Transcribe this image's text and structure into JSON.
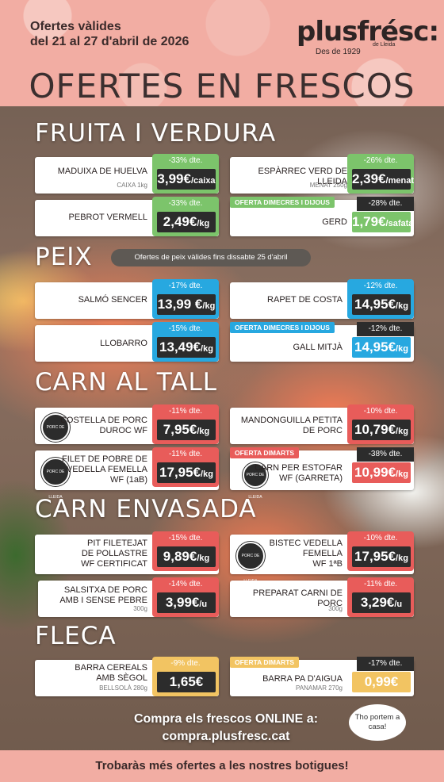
{
  "header": {
    "validity_line1": "Ofertes vàlides",
    "validity_line2": "del 21 al 27 d'abril de 2026",
    "logo": "plusfrésc:",
    "logo_sub": "Des de 1929",
    "logo_sub2": "de Lleida",
    "headline": "OFERTES EN FRESCOS"
  },
  "sections": {
    "fruita": "FRUITA I VERDURA",
    "peix": "PEIX",
    "peix_note": "Ofertes de peix vàlides fins dissabte 25 d'abril",
    "carn_tall": "CARN AL TALL",
    "carn_envasada": "CARN ENVASADA",
    "fleca": "FLECA"
  },
  "products": [
    {
      "name": "MADUIXA DE HUELVA",
      "unit": "CAIXA 1kg",
      "discount": "-33% dte.",
      "price": "3,99€",
      "price_unit": "/caixa",
      "color": "#7cc46b"
    },
    {
      "name": "ESPÀRREC VERD DE LLEIDA",
      "unit": "MENAT 250g",
      "discount": "-26% dte.",
      "price": "2,39€",
      "price_unit": "/menat",
      "color": "#7cc46b"
    },
    {
      "name": "PEBROT VERMELL",
      "unit": "",
      "discount": "-33% dte.",
      "price": "2,49€",
      "price_unit": "/kg",
      "color": "#7cc46b"
    },
    {
      "name": "GERD",
      "unit": "",
      "offer": "OFERTA DIMECRES I DIJOUS",
      "discount": "-28% dte.",
      "price": "1,79€",
      "price_unit": "/safata",
      "color": "#7cc46b"
    },
    {
      "name": "SALMÓ SENCER",
      "unit": "",
      "discount": "-17% dte.",
      "price": "13,99 €",
      "price_unit": "/kg",
      "color": "#27a8e0"
    },
    {
      "name": "RAPET DE COSTA",
      "unit": "",
      "discount": "-12% dte.",
      "price": "14,95€",
      "price_unit": "/kg",
      "color": "#27a8e0"
    },
    {
      "name": "LLOBARRO",
      "unit": "",
      "discount": "-15% dte.",
      "price": "13,49€",
      "price_unit": "/kg",
      "color": "#27a8e0"
    },
    {
      "name": "GALL MITJÀ",
      "unit": "",
      "offer": "OFERTA DIMECRES I DIJOUS",
      "discount": "-12% dte.",
      "price": "14,95€",
      "price_unit": "/kg",
      "color": "#27a8e0"
    },
    {
      "name_l1": "COSTELLA DE PORC",
      "name_l2": "DUROC WF",
      "discount": "-11% dte.",
      "price": "7,95€",
      "price_unit": "/kg",
      "color": "#e85c5a"
    },
    {
      "name_l1": "MANDONGUILLA PETITA",
      "name_l2": "DE PORC",
      "discount": "-10% dte.",
      "price": "10,79€",
      "price_unit": "/kg",
      "color": "#e85c5a"
    },
    {
      "name_l1": "FILET DE POBRE DE",
      "name_l2": "VEDELLA FEMELLA",
      "name_l3": "WF (1aB)",
      "discount": "-11% dte.",
      "price": "17,95€",
      "price_unit": "/kg",
      "color": "#e85c5a"
    },
    {
      "name_l1": "CARN PER ESTOFAR",
      "name_l2": "WF (GARRETA)",
      "offer": "OFERTA DIMARTS",
      "discount": "-38% dte.",
      "price": "10,99€",
      "price_unit": "/kg",
      "color": "#e85c5a"
    },
    {
      "name_l1": "PIT FILETEJAT",
      "name_l2": "DE POLLASTRE",
      "name_l3": "WF CERTIFICAT",
      "discount": "-15% dte.",
      "price": "9,89€",
      "price_unit": "/kg",
      "color": "#e85c5a"
    },
    {
      "name_l1": "BISTEC VEDELLA",
      "name_l2": "FEMELLA",
      "name_l3": "WF 1ªB",
      "discount": "-10% dte.",
      "price": "17,95€",
      "price_unit": "/kg",
      "color": "#e85c5a"
    },
    {
      "name_l1": "SALSITXA DE PORC",
      "name_l2": "AMB I SENSE PEBRE",
      "unit": "300g",
      "discount": "-14% dte.",
      "price": "3,99€",
      "price_unit": "/u",
      "color": "#e85c5a"
    },
    {
      "name_l1": "PREPARAT CARNI DE PORC",
      "unit": "300g",
      "discount": "-11% dte.",
      "price": "3,29€",
      "price_unit": "/u",
      "color": "#e85c5a"
    },
    {
      "name_l1": "BARRA CEREALS",
      "name_l2": "AMB SÈGOL",
      "unit": "BELLSOLÀ 280g",
      "discount": "-9% dte.",
      "price": "1,65€",
      "price_unit": "",
      "color": "#f2c462"
    },
    {
      "name_l1": "BARRA PA D'AIGUA",
      "unit": "PANAMAR 270g",
      "offer": "OFERTA DIMARTS",
      "discount": "-17% dte.",
      "price": "0,99€",
      "price_unit": "",
      "color": "#f2c462"
    }
  ],
  "badge_text": "PORC DE LLEIDA",
  "online": {
    "line1": "Compra els frescos ONLINE a:",
    "line2": "compra.plusfresc.cat",
    "bubble": "Tho portem a casa!"
  },
  "footer": "Trobaràs més ofertes a les nostres botigues!"
}
